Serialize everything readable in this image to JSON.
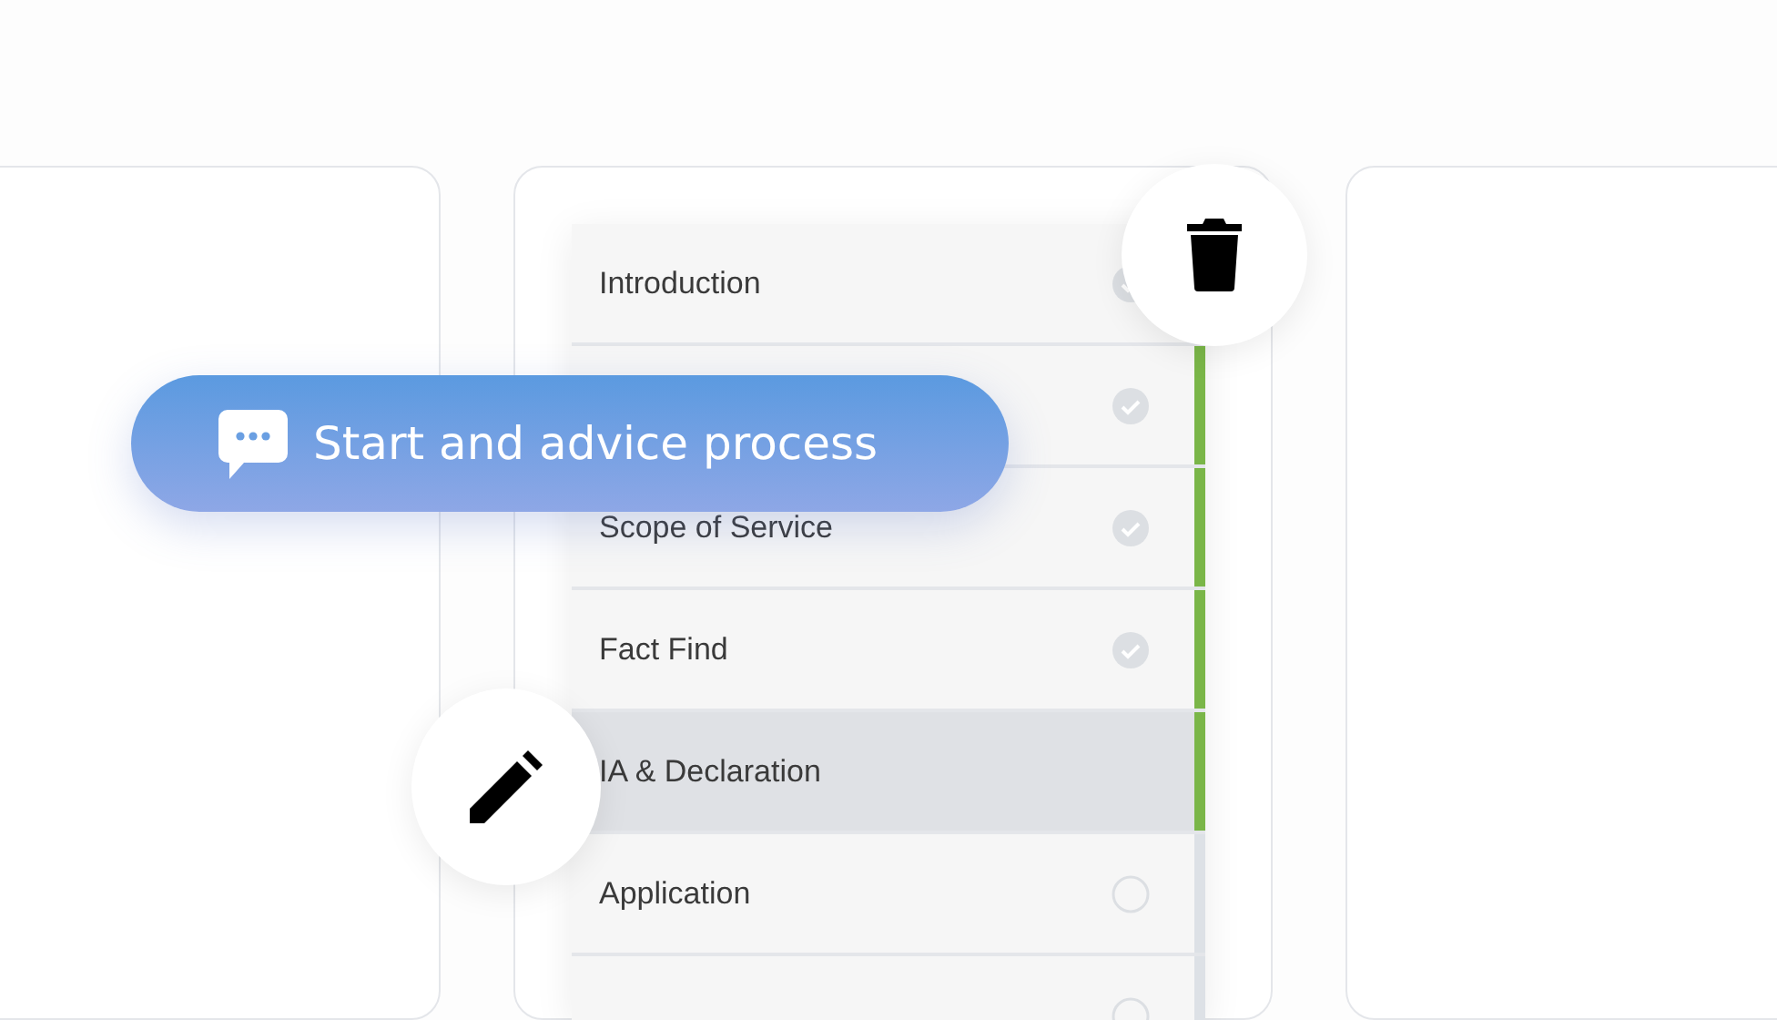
{
  "steps": [
    {
      "label": "Introduction",
      "completed": true,
      "selected": false
    },
    {
      "completed": true,
      "selected": false
    },
    {
      "label": "Scope of Service",
      "completed": true,
      "selected": false
    },
    {
      "label": "Fact Find",
      "completed": true,
      "selected": false
    },
    {
      "label": "IA & Declaration",
      "completed": false,
      "selected": true
    },
    {
      "label": "Application",
      "completed": false,
      "selected": false
    },
    {
      "completed": false,
      "selected": false
    }
  ],
  "start_button": {
    "label": "Start and advice process"
  }
}
